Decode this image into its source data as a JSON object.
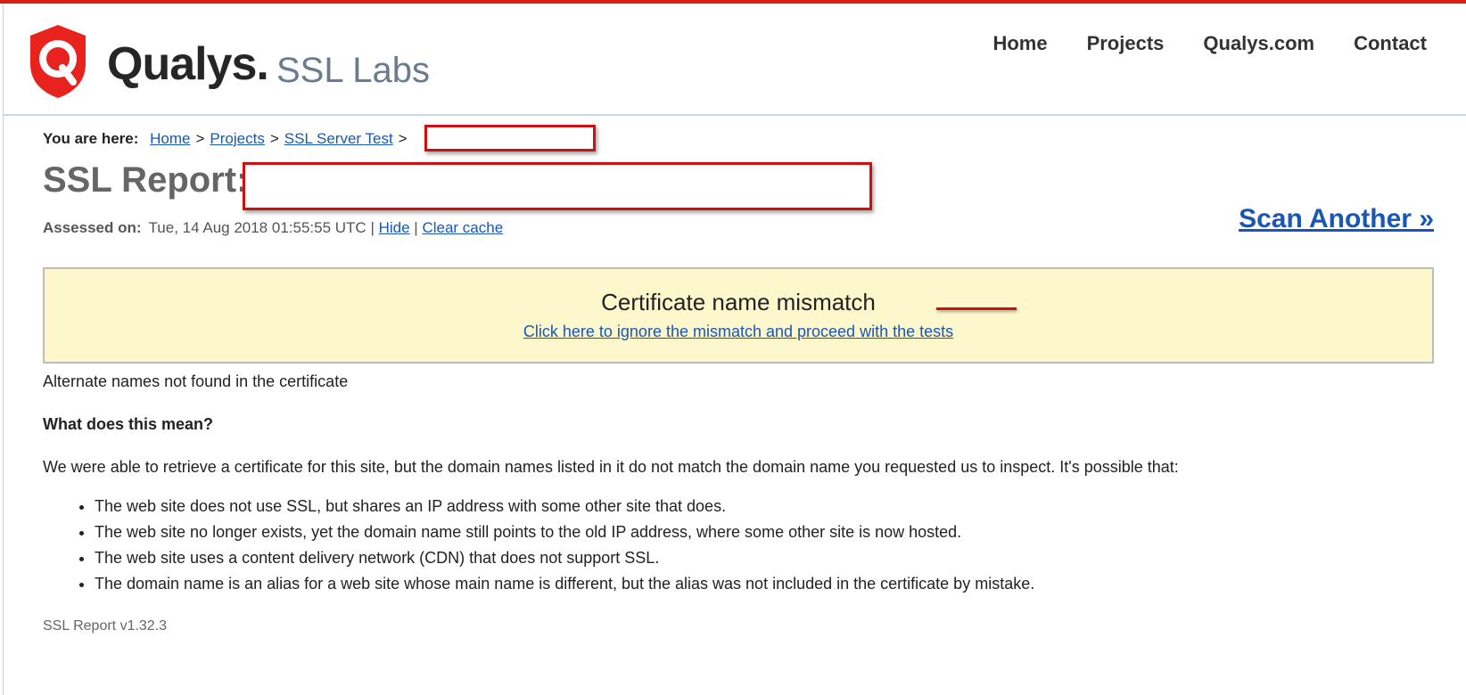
{
  "header": {
    "brand": "Qualys",
    "product": "SSL Labs",
    "nav": [
      "Home",
      "Projects",
      "Qualys.com",
      "Contact"
    ],
    "accent_color": "#dd1e12"
  },
  "breadcrumb": {
    "lead": "You are here:",
    "items": [
      "Home",
      "Projects",
      "SSL Server Test"
    ],
    "separator": ">"
  },
  "report": {
    "title": "SSL Report:",
    "assessed_label": "Assessed on:",
    "assessed_value": "Tue, 14 Aug 2018 01:55:55 UTC",
    "divider": "|",
    "hide": "Hide",
    "clear_cache": "Clear cache",
    "scan_another": "Scan Another »"
  },
  "warning": {
    "title": "Certificate name mismatch",
    "link": "Click here to ignore the mismatch and proceed with the tests",
    "background": "#fdf8cc"
  },
  "body": {
    "alt_names": "Alternate names not found in the certificate",
    "question": "What does this mean?",
    "explanation": "We were able to retrieve a certificate for this site, but the domain names listed in it do not match the domain name you requested us to inspect. It's possible that:",
    "reasons": [
      "The web site does not use SSL, but shares an IP address with some other site that does.",
      "The web site no longer exists, yet the domain name still points to the old IP address, where some other site is now hosted.",
      "The web site uses a content delivery network (CDN) that does not support SSL.",
      "The domain name is an alias for a web site whose main name is different, but the alias was not included in the certificate by mistake."
    ]
  },
  "footer": {
    "version": "SSL Report v1.32.3"
  },
  "icons": {
    "logo": "qualys-shield-icon"
  }
}
